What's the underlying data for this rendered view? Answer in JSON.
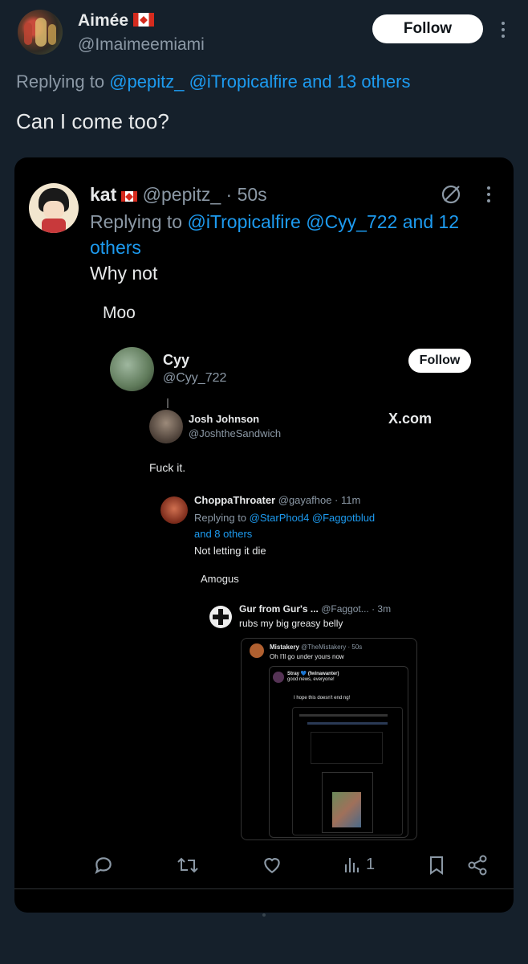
{
  "outer": {
    "name": "Aimée",
    "handle": "@Imaimeemiami",
    "follow_label": "Follow",
    "replying_prefix": "Replying to",
    "replying_mentions": "@pepitz_ @iTropicalfire and 13 others",
    "text": "Can I come too?"
  },
  "quoted": {
    "name": "kat",
    "handle": "@pepitz_",
    "time": "· 50s",
    "replying_prefix": "Replying to",
    "replying_line1": "@iTropicalfire @Cyy_722 and 12",
    "replying_line2": "others",
    "text": "Why not",
    "screenshot": {
      "moo": "Moo",
      "cyy_name": "Cyy",
      "cyy_handle": "@Cyy_722",
      "cyy_follow": "Follow",
      "josh_name": "Josh Johnson",
      "josh_handle": "@JoshtheSandwich",
      "xcom": "X.com",
      "fuck_it": "Fuck it.",
      "choppa_name": "ChoppaThroater",
      "choppa_handle": "@gayafhoe · 11m",
      "choppa_reply_prefix": "Replying to",
      "choppa_reply_mentions": "@StarPhod4 @Faggotblud",
      "choppa_reply_line2": "and 8 others",
      "choppa_text": "Not letting it die",
      "amogus": "Amogus",
      "gur_name": "Gur from Gur's ...",
      "gur_handle": "@Faggot... · 3m",
      "gur_text": "rubs my big greasy belly",
      "mistakery_name": "Mistakery",
      "mistakery_handle": "@TheMistakery · 50s",
      "mistakery_text": "Oh I'll go under yours now",
      "stray_name": "Stray 💙 (fwinawanter)",
      "stray_text": "good news, everyone!",
      "hope_text": "I hope this doesn't end ng!"
    },
    "views": "1"
  },
  "icons": {
    "more": "more-icon",
    "grok": "no-sign-icon",
    "reply": "reply-icon",
    "retweet": "retweet-icon",
    "like": "like-icon",
    "views": "views-icon",
    "bookmark": "bookmark-icon",
    "share": "share-icon"
  },
  "colors": {
    "background": "#15202b",
    "card": "#000000",
    "link": "#1d9bf0",
    "muted": "#8b98a5",
    "text": "#e7e9ea"
  }
}
